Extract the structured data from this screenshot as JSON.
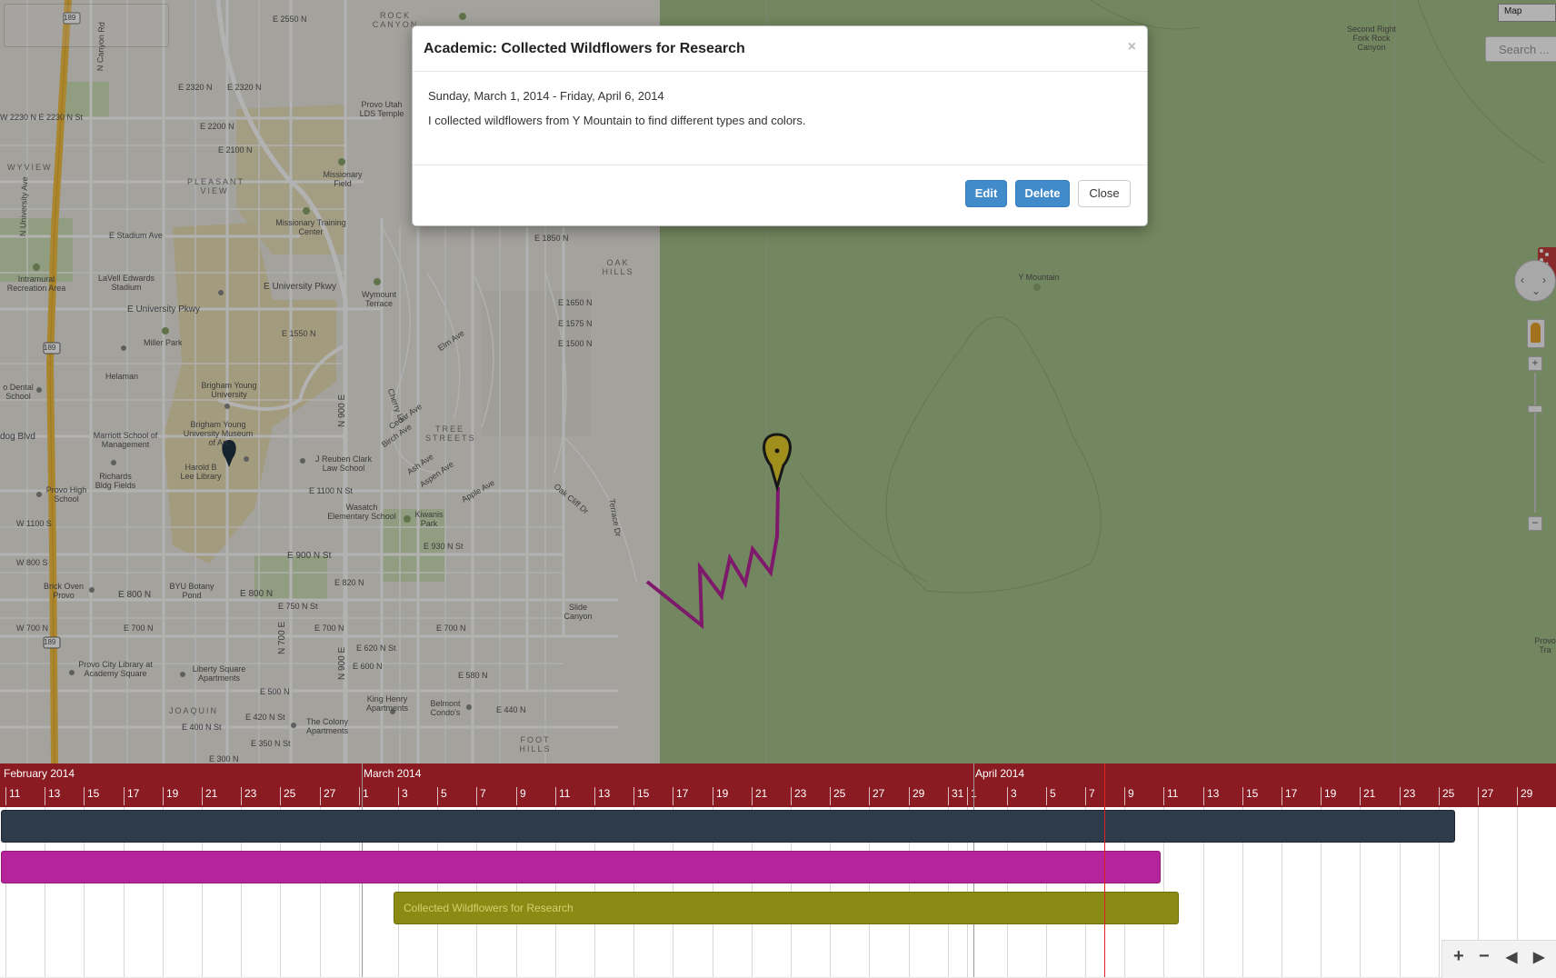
{
  "map": {
    "type_label": "Map",
    "search_placeholder": "Search ...",
    "labels": {
      "n_university_ave": "N University Ave",
      "n_canyon_rd": "N Canyon Rd",
      "e_2550_n": "E 2550 N",
      "e_2320_n_a": "E 2320 N",
      "e_2320_n_b": "E 2320 N",
      "e_2230_n": "W 2230 N    E 2230 N St",
      "e_2200_n": "E 2200 N",
      "e_2100_n": "E 2100 N",
      "provo_utah_lds_temple": "Provo Utah LDS Temple",
      "missionary_field": "Missionary Field",
      "pleasant_view": "PLEASANT VIEW",
      "wyview": "WYVIEW",
      "missionary_training_center": "Missionary Training Center",
      "e_stadium_ave": "E Stadium Ave",
      "wymount_terrace": "Wymount Terrace",
      "rock_canyon": "ROCK CANYON",
      "oak_hills": "OAK HILLS",
      "intramural": "Intramural Recreation Area",
      "lavell_edwards_stadium": "LaVell Edwards Stadium",
      "e_university_pkwy_a": "E University Pkwy",
      "e_university_pkwy_b": "E University Pkwy",
      "miller_park": "Miller Park",
      "e_1550_n": "E 1550 N",
      "e_1650_n": "E 1650 N",
      "e_1575_n": "E 1575 N",
      "e_1500_n": "E 1500 N",
      "e_1850_n": "E 1850 N",
      "byu": "Brigham Young University",
      "byu_museum": "Brigham Young University Museum of Art",
      "marriott_school": "Marriott School of Management",
      "harold_b_lee": "Harold B Lee Library",
      "richards_bldg": "Richards Bldg Fields",
      "provo_high": "Provo High School",
      "j_reuben_clark": "J Reuben Clark Law School",
      "tree_streets": "TREE STREETS",
      "wasatch_elementary": "Wasatch Elementary School",
      "kiwanis_park": "Kiwanis Park",
      "e_930_n": "E 930 N St",
      "e_900_n": "E 900 N St",
      "e_1100_n": "E 1100 N St",
      "e_820_n": "E 820 N",
      "e_800_n_a": "E 800 N",
      "e_800_n_b": "E 800 N",
      "byu_botany_pond": "BYU Botany Pond",
      "brick_oven": "Brick Oven Provo",
      "e_750_n": "E 750 N St",
      "e_700_n_a": "E 700 N",
      "e_700_n_b": "E 700 N",
      "w_700_n": "W 700 N",
      "e_620_n": "E 620 N St",
      "e_600_n": "E 600 N",
      "e_700_n_c": "E 700 N",
      "slide_canyon": "Slide Canyon",
      "provo_city_library": "Provo City Library at Academy Square",
      "liberty_square": "Liberty Square Apartments",
      "e_500_n": "E 500 N",
      "joaquin": "JOAQUIN",
      "e_420_n": "E 420 N St",
      "e_400_n": "E 400 N St",
      "e_350_n": "E 350 N St",
      "e_300_n": "E 300 N",
      "the_colony": "The Colony Apartments",
      "king_henry": "King Henry Apartments",
      "belmont": "Belmont Condo's",
      "foot_hills": "FOOT HILLS",
      "e_440_n": "E 440 N",
      "e_580_n": "E 580 N",
      "dental_school": "o Dental School",
      "dog_blvd": "dog Blvd",
      "w_1100_s": "W 1100 S",
      "w_800_s": "W 800 S",
      "helaman": "Helaman",
      "y_mountain": "Y Mountain",
      "second_right_fork": "Second Right Fork Rock Canyon",
      "provo_tra": "Provo Tra",
      "rd_189_a": "189",
      "rd_189_b": "189",
      "rd_189_c": "189",
      "n_900_e": "N 900 E",
      "n_700_e": "N 700 E",
      "n_900_e_b": "N 900 E",
      "terrace_dr": "Terrace Dr",
      "oak_cliff_dr": "Oak Cliff Dr",
      "cedar_ave": "Cedar Ave",
      "elm_ave": "Elm Ave",
      "ash_ave": "Ash Ave",
      "apple_ave": "Apple Ave",
      "aspen_ave": "Aspen Ave",
      "birch_ave": "Birch Ave",
      "cherry_ln": "Cherry Ln"
    }
  },
  "modal": {
    "title": "Academic: Collected Wildflowers for Research",
    "close_symbol": "×",
    "dates": "Sunday, March 1, 2014 - Friday, April 6, 2014",
    "description": "I collected wildflowers from Y Mountain to find different types and colors.",
    "edit_label": "Edit",
    "delete_label": "Delete",
    "close_label": "Close"
  },
  "timeline": {
    "months": [
      {
        "label": "February 2014"
      },
      {
        "label": "March 2014"
      },
      {
        "label": "April 2014"
      }
    ],
    "days": [
      "11",
      "13",
      "15",
      "17",
      "19",
      "21",
      "23",
      "25",
      "27",
      "1",
      "3",
      "5",
      "7",
      "9",
      "11",
      "13",
      "15",
      "17",
      "19",
      "21",
      "23",
      "25",
      "27",
      "29",
      "31",
      "1",
      "3",
      "5",
      "7",
      "9",
      "11",
      "13",
      "15",
      "17",
      "19",
      "21",
      "23",
      "25",
      "27",
      "29"
    ],
    "event_label": "Collected Wildflowers for Research",
    "colors": {
      "header": "#8b1b22",
      "bar1": "#2d3b4a",
      "bar2": "#b5249a",
      "bar3": "#8a8b14",
      "now": "#e02020"
    },
    "controls": {
      "zoom_in": "+",
      "zoom_out": "−",
      "prev": "◀",
      "next": "▶"
    }
  }
}
